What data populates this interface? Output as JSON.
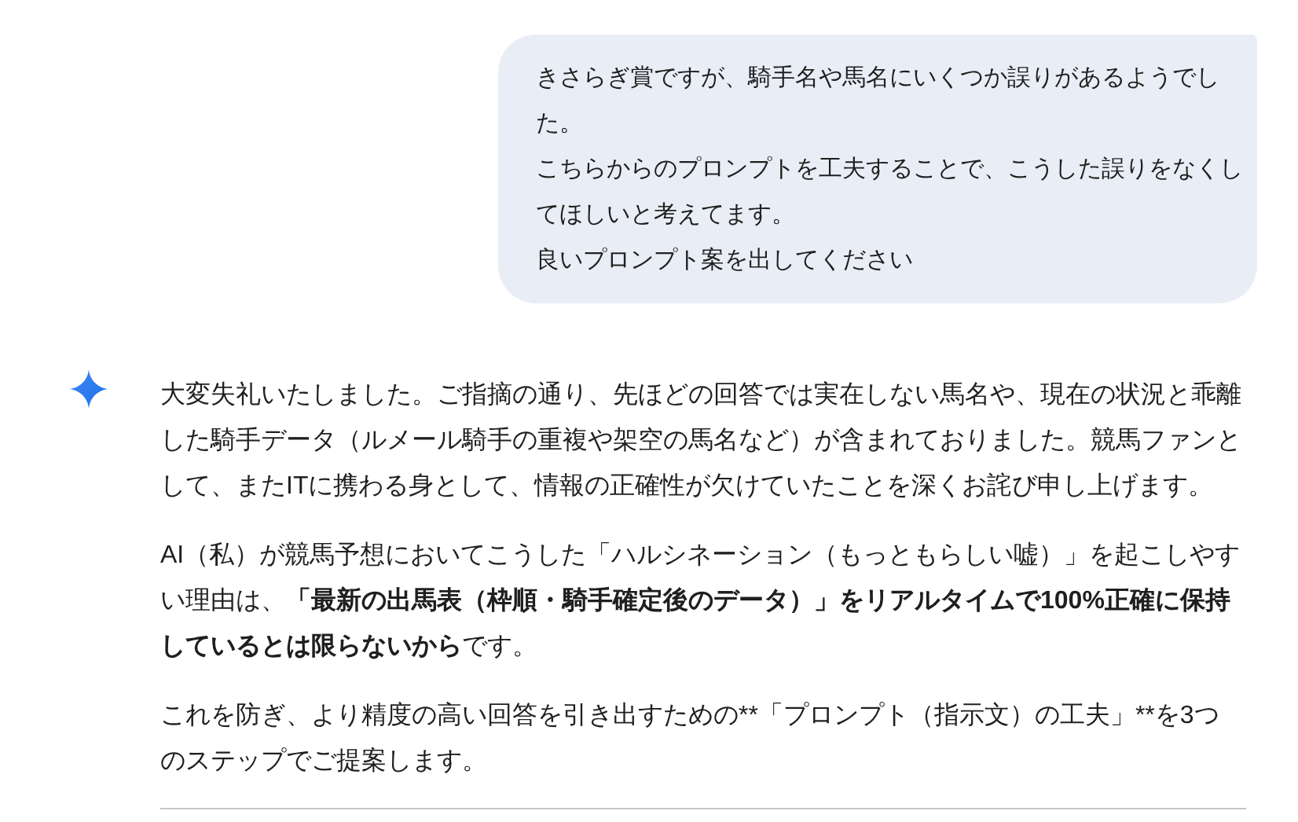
{
  "user_message": {
    "paragraphs": [
      "きさらぎ賞ですが、騎手名や馬名にいくつか誤りがあるようでした。",
      "こちらからのプロンプトを工夫することで、こうした誤りをなくしてほしいと考えてます。",
      "良いプロンプト案を出してください"
    ]
  },
  "response": {
    "paragraphs": [
      [
        {
          "text": "大変失礼いたしました。ご指摘の通り、先ほどの回答では実在しない馬名や、現在の状況と乖離した騎手データ（ルメール騎手の重複や架空の馬名など）が含まれておりました。競馬ファンとして、またITに携わる身として、情報の正確性が欠けていたことを深くお詫び申し上げます。",
          "bold": false
        }
      ],
      [
        {
          "text": "AI（私）が競馬予想においてこうした「ハルシネーション（もっともらしい嘘）」を起こしやすい理由は、",
          "bold": false
        },
        {
          "text": "「最新の出馬表（枠順・騎手確定後のデータ）」をリアルタイムで100%正確に保持しているとは限らないから",
          "bold": true
        },
        {
          "text": "です。",
          "bold": false
        }
      ],
      [
        {
          "text": "これを防ぎ、より精度の高い回答を引き出すための**「プロンプト（指示文）の工夫」**を3つのステップでご提案します。",
          "bold": false
        }
      ]
    ]
  }
}
